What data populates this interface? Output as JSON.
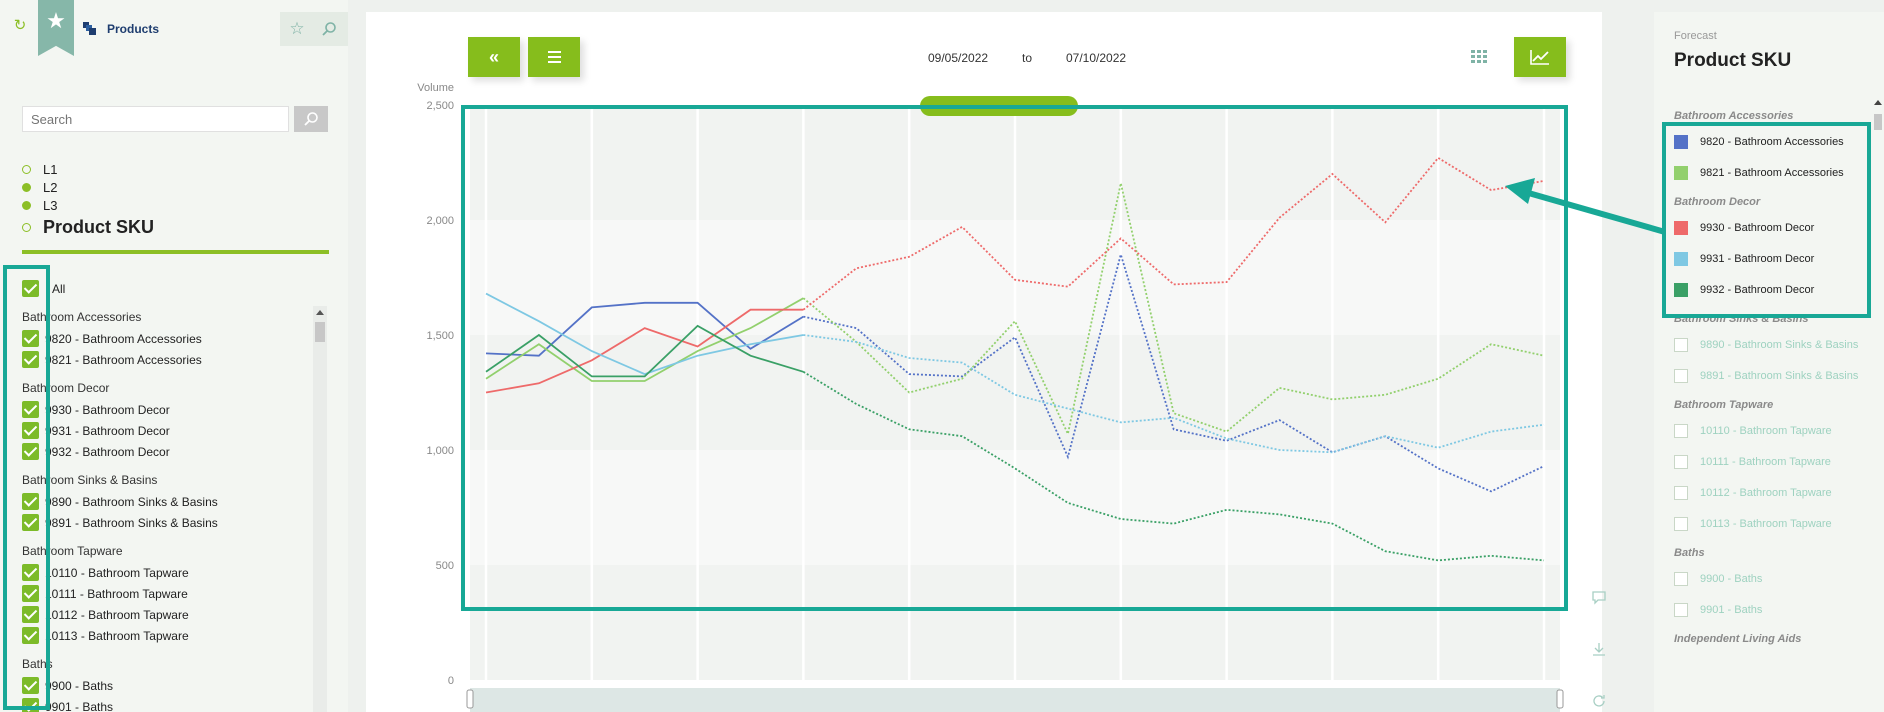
{
  "sidebar": {
    "app_title": "Products",
    "search": {
      "placeholder": "Search",
      "value": ""
    },
    "levels": [
      {
        "label": "L1",
        "filled": false
      },
      {
        "label": "L2",
        "filled": true
      },
      {
        "label": "L3",
        "filled": true
      },
      {
        "label": "Product SKU",
        "filled": false
      }
    ],
    "all_label": "All",
    "tree": [
      {
        "group": "Bathroom Accessories",
        "items": [
          "9820 - Bathroom Accessories",
          "9821 - Bathroom Accessories"
        ]
      },
      {
        "group": "Bathroom Decor",
        "items": [
          "9930 - Bathroom Decor",
          "9931 - Bathroom Decor",
          "9932 - Bathroom Decor"
        ]
      },
      {
        "group": "Bathroom Sinks & Basins",
        "items": [
          "9890 - Bathroom Sinks & Basins",
          "9891 - Bathroom Sinks & Basins"
        ]
      },
      {
        "group": "Bathroom Tapware",
        "items": [
          "10110 - Bathroom Tapware",
          "10111 - Bathroom Tapware",
          "10112 - Bathroom Tapware",
          "10113 - Bathroom Tapware"
        ]
      },
      {
        "group": "Baths",
        "items": [
          "9900 - Baths",
          "9901 - Baths"
        ]
      }
    ]
  },
  "toolbar": {
    "collapse_label": "«",
    "date_from": "09/05/2022",
    "date_sep": "to",
    "date_to": "07/10/2022"
  },
  "chart_data": {
    "type": "line",
    "ylabel": "Volume",
    "ylim": [
      0,
      2500
    ],
    "yticks": [
      "2,500",
      "2,000",
      "1,500",
      "1,000",
      "500",
      "0"
    ],
    "yticks_values": [
      2500,
      2000,
      1500,
      1000,
      500,
      0
    ],
    "x_count": 21,
    "actual_until_index": 6,
    "series": [
      {
        "color": "#5472c7",
        "values": [
          1420,
          1410,
          1620,
          1640,
          1640,
          1440,
          1580,
          1530,
          1330,
          1320,
          1490,
          970,
          1850,
          1090,
          1040,
          1130,
          990,
          1060,
          920,
          820,
          930
        ]
      },
      {
        "color": "#92d06d",
        "values": [
          1310,
          1460,
          1300,
          1300,
          1430,
          1530,
          1660,
          1470,
          1250,
          1310,
          1560,
          1070,
          2160,
          1160,
          1080,
          1270,
          1220,
          1240,
          1310,
          1460,
          1410
        ]
      },
      {
        "color": "#ee6a6a",
        "values": [
          1250,
          1290,
          1390,
          1530,
          1450,
          1610,
          1610,
          1790,
          1840,
          1970,
          1740,
          1710,
          1920,
          1720,
          1730,
          2010,
          2200,
          1990,
          2270,
          2130,
          2170
        ]
      },
      {
        "color": "#7ec8e3",
        "values": [
          1680,
          1560,
          1430,
          1330,
          1410,
          1460,
          1500,
          1470,
          1400,
          1380,
          1240,
          1180,
          1120,
          1140,
          1050,
          1000,
          990,
          1060,
          1010,
          1080,
          1110
        ]
      },
      {
        "color": "#3aa066",
        "values": [
          1340,
          1500,
          1320,
          1320,
          1540,
          1410,
          1340,
          1200,
          1090,
          1060,
          920,
          770,
          700,
          680,
          740,
          720,
          680,
          560,
          520,
          540,
          520
        ]
      }
    ]
  },
  "legend": {
    "caption": "Forecast",
    "title": "Product SKU",
    "groups": [
      {
        "group": "Bathroom Accessories",
        "items": [
          {
            "label": "9820 - Bathroom Accessories",
            "color": "#5472c7",
            "active": true
          },
          {
            "label": "9821 - Bathroom Accessories",
            "color": "#92d06d",
            "active": true
          }
        ]
      },
      {
        "group": "Bathroom Decor",
        "items": [
          {
            "label": "9930 - Bathroom Decor",
            "color": "#ee6a6a",
            "active": true
          },
          {
            "label": "9931 - Bathroom Decor",
            "color": "#7ec8e3",
            "active": true
          },
          {
            "label": "9932 - Bathroom Decor",
            "color": "#3aa066",
            "active": true
          }
        ]
      },
      {
        "group": "Bathroom Sinks & Basins",
        "items": [
          {
            "label": "9890 - Bathroom Sinks & Basins",
            "active": false
          },
          {
            "label": "9891 - Bathroom Sinks & Basins",
            "active": false
          }
        ]
      },
      {
        "group": "Bathroom Tapware",
        "items": [
          {
            "label": "10110 - Bathroom Tapware",
            "active": false
          },
          {
            "label": "10111 - Bathroom Tapware",
            "active": false
          },
          {
            "label": "10112 - Bathroom Tapware",
            "active": false
          },
          {
            "label": "10113 - Bathroom Tapware",
            "active": false
          }
        ]
      },
      {
        "group": "Baths",
        "items": [
          {
            "label": "9900 - Baths",
            "active": false
          },
          {
            "label": "9901 - Baths",
            "active": false
          }
        ]
      },
      {
        "group": "Independent Living Aids",
        "items": []
      }
    ]
  },
  "colors": {
    "accent": "#86bd1c",
    "highlight": "#18a896"
  }
}
